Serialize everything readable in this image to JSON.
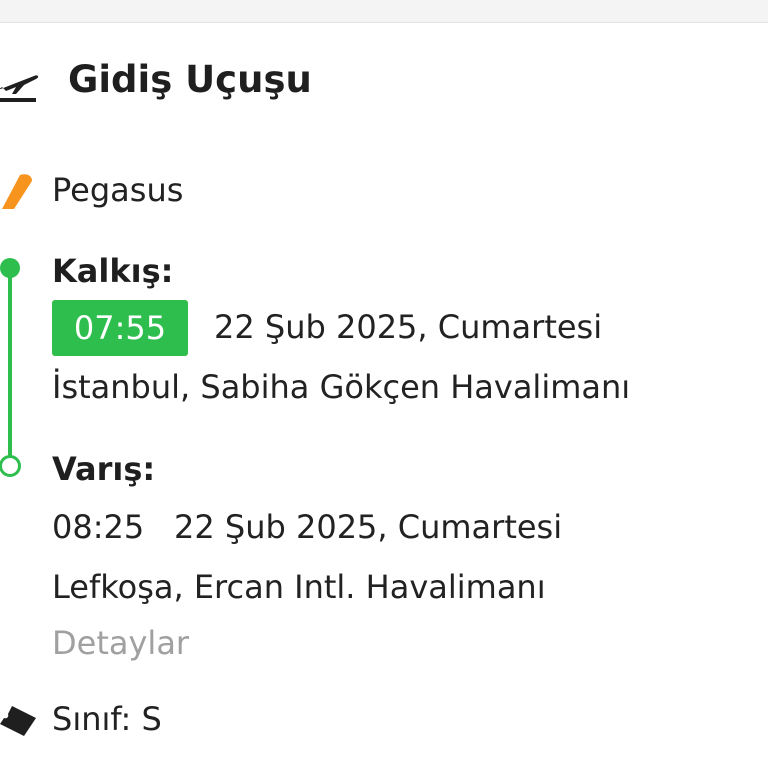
{
  "section": {
    "title": "Gidiş Uçuşu",
    "icon": "airplane-takeoff-icon"
  },
  "airline": {
    "name": "Pegasus",
    "logo_icon": "pegasus-logo",
    "logo_color": "#f7941d"
  },
  "departure": {
    "label": "Kalkış:",
    "time": "07:55",
    "date": "22 Şub 2025, Cumartesi",
    "airport": "İstanbul, Sabiha Gökçen Havalimanı"
  },
  "arrival": {
    "label": "Varış:",
    "time": "08:25",
    "date": "22 Şub 2025, Cumartesi",
    "airport": "Lefkoşa, Ercan Intl. Havalimanı"
  },
  "details_link": "Detaylar",
  "cabin_class": {
    "text": "Sınıf: S",
    "icon": "ticket-icon"
  },
  "colors": {
    "accent_green": "#2dbe4e",
    "muted_text": "#a0a0a0"
  }
}
